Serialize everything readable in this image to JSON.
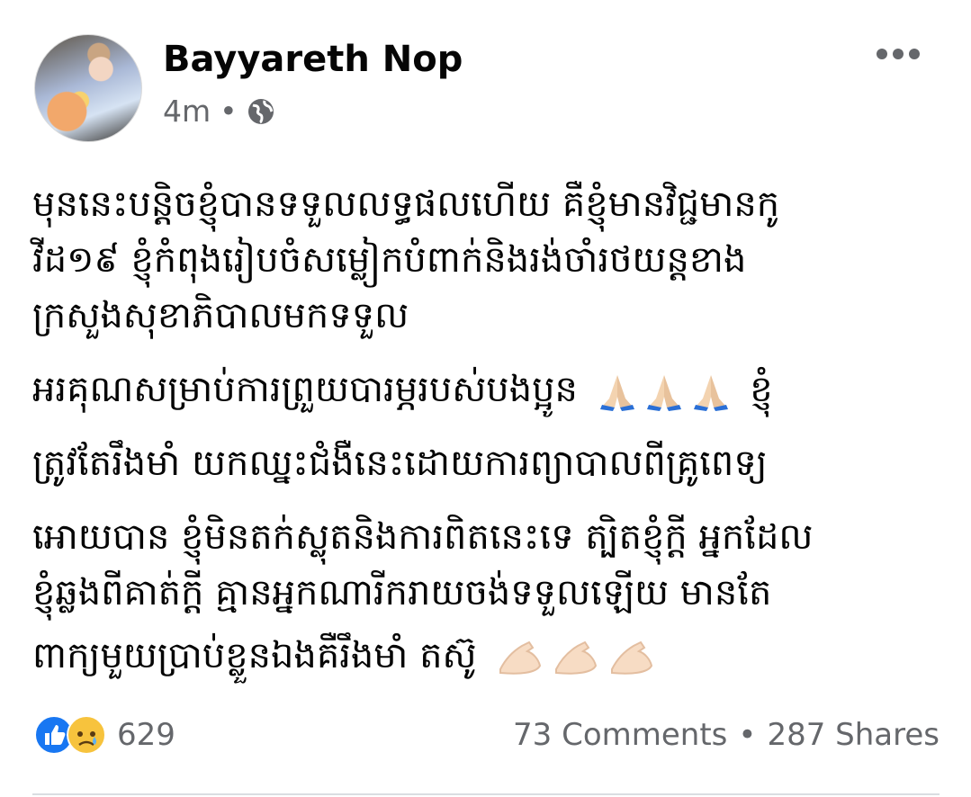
{
  "post": {
    "author": "Bayyareth Nop",
    "time": "4m",
    "separator": "•",
    "privacy_icon": "globe-icon",
    "options_icon": "more-horizontal-icon",
    "body_lines": [
      "មុននេះបន្តិចខ្ញុំបានទទួលលទ្ធផលហើយ គឺខ្ញុំមានវិជ្ជមានកូ",
      "វីដ១៩ ខ្ញុំកំពុងរៀបចំសម្លៀកបំពាក់និងរង់ចាំរថយន្តខាង",
      "ក្រសួងសុខាភិបាលមកទទួល",
      "អរគុណសម្រាប់ការព្រួយបារម្ភរបស់បងប្អូន",
      "ខ្ញុំ",
      "ត្រូវតែរឹងមាំ យកឈ្នះជំងឺនេះដោយការព្យាបាលពីគ្រូពេទ្យ",
      "អោយបាន ខ្ញុំមិនតក់ស្លុតនិងការពិតនេះទេ ត្បិតខ្ញុំក្តី អ្នកដែល",
      "ខ្ញុំឆ្លងពីគាត់ក្តី គ្មានអ្នកណារីករាយចង់ទទួលឡើយ មានតែ",
      "ពាក្យមួយប្រាប់ខ្លួនឯងគឺរឹងមាំ តស៊ូ"
    ],
    "emojis": {
      "pray": "folded-hands-emoji",
      "flex": "flexed-biceps-emoji"
    },
    "reactions": {
      "icons": [
        "like-icon",
        "sad-icon"
      ],
      "count": "629"
    },
    "comments": "73 Comments",
    "shares": "287 Shares",
    "colors": {
      "like_blue": "#1877f2",
      "meta_gray": "#65676b"
    }
  }
}
